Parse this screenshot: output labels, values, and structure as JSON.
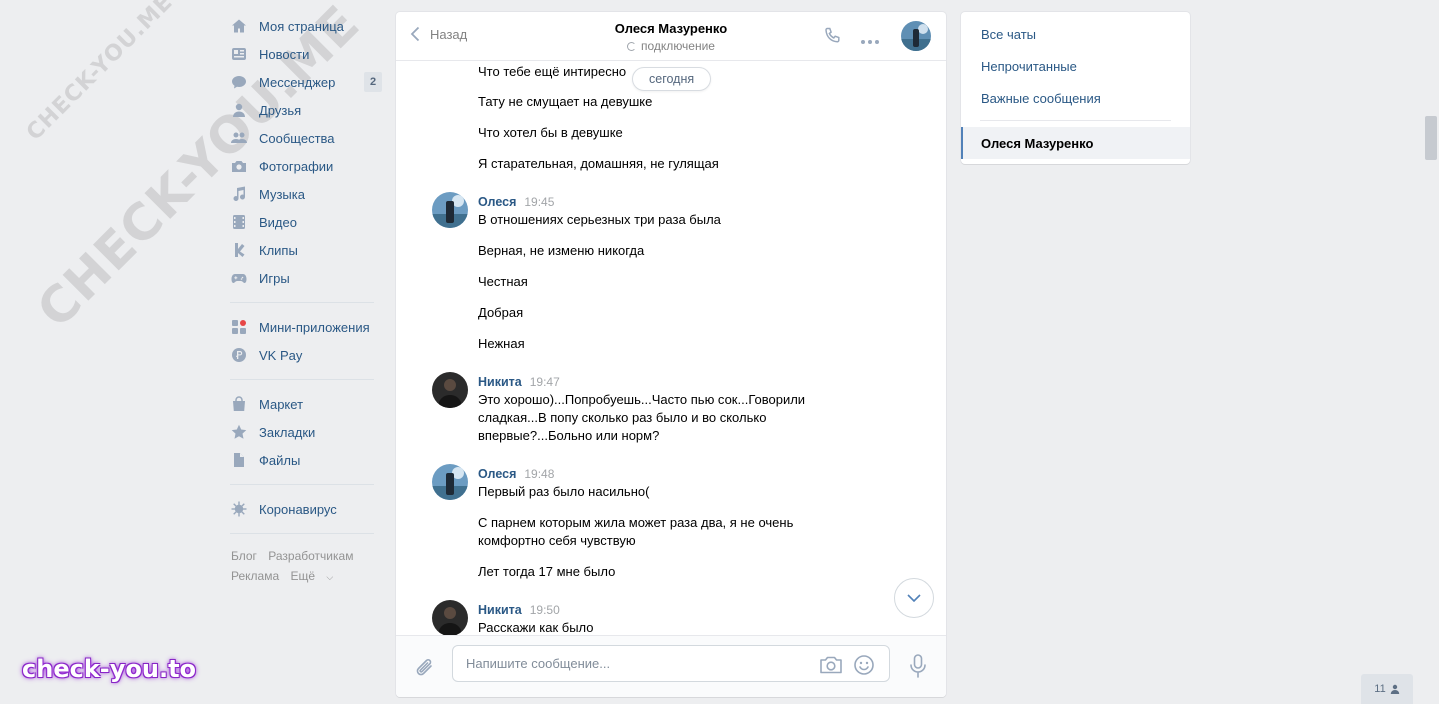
{
  "watermarks": {
    "small": "CHECK-YOU.ME",
    "large": "CHECK-YOU.ME",
    "bottom": "check-you.to"
  },
  "nav": {
    "items": [
      {
        "label": "Моя страница",
        "icon": "home-icon"
      },
      {
        "label": "Новости",
        "icon": "news-icon"
      },
      {
        "label": "Мессенджер",
        "icon": "messenger-icon",
        "badge": "2"
      },
      {
        "label": "Друзья",
        "icon": "friends-icon"
      },
      {
        "label": "Сообщества",
        "icon": "communities-icon"
      },
      {
        "label": "Фотографии",
        "icon": "camera-icon"
      },
      {
        "label": "Музыка",
        "icon": "music-icon"
      },
      {
        "label": "Видео",
        "icon": "video-icon"
      },
      {
        "label": "Клипы",
        "icon": "clips-icon"
      },
      {
        "label": "Игры",
        "icon": "gamepad-icon"
      }
    ],
    "items2": [
      {
        "label": "Мини-приложения",
        "icon": "apps-icon"
      },
      {
        "label": "VK Pay",
        "icon": "vkpay-icon"
      }
    ],
    "items3": [
      {
        "label": "Маркет",
        "icon": "market-icon"
      },
      {
        "label": "Закладки",
        "icon": "star-icon"
      },
      {
        "label": "Файлы",
        "icon": "file-icon"
      }
    ],
    "items4": [
      {
        "label": "Коронавирус",
        "icon": "virus-icon"
      }
    ],
    "footer": {
      "blog": "Блог",
      "developers": "Разработчикам",
      "ads": "Реклама",
      "more": "Ещё"
    }
  },
  "chat": {
    "back_label": "Назад",
    "title": "Олеся Мазуренко",
    "status": "подключение",
    "date_pill": "сегодня",
    "scroll_down_icon": "chevron-down-icon",
    "input_placeholder": "Напишите сообщение...",
    "messages_top": [
      "Что тебе ещё интиресно",
      "Тату не смущает на девушке",
      "Что хотел бы в девушке",
      "Я старательная, домашняя, не гулящая"
    ],
    "groups": [
      {
        "author": "Олеся",
        "time": "19:45",
        "lines": [
          "В отношениях серьезных три раза была",
          "Верная, не изменю никогда",
          "Честная",
          "Добрая",
          "Нежная"
        ]
      },
      {
        "author": "Никита",
        "time": "19:47",
        "lines": [
          "Это хорошо)...Попробуешь...Часто пью сок...Говорили",
          "сладкая...В попу сколько раз было и во сколько",
          "впервые?...Больно или норм?"
        ]
      },
      {
        "author": "Олеся",
        "time": "19:48",
        "lines": [
          "Первый раз было насильно(",
          "С парнем которым жила может раза два, я не очень",
          "комфортно себя чувствую",
          "Лет тогда 17 мне было"
        ]
      },
      {
        "author": "Никита",
        "time": "19:50",
        "lines": [
          "Расскажи как было"
        ]
      }
    ]
  },
  "filters": {
    "all": "Все чаты",
    "unread": "Непрочитанные",
    "important": "Важные сообщения",
    "active": "Олеся Мазуренко"
  },
  "online_count": "11",
  "colors": {
    "link": "#2a5885",
    "background": "#edeef0",
    "icon": "#99a8bc",
    "accent": "#5181b8"
  }
}
